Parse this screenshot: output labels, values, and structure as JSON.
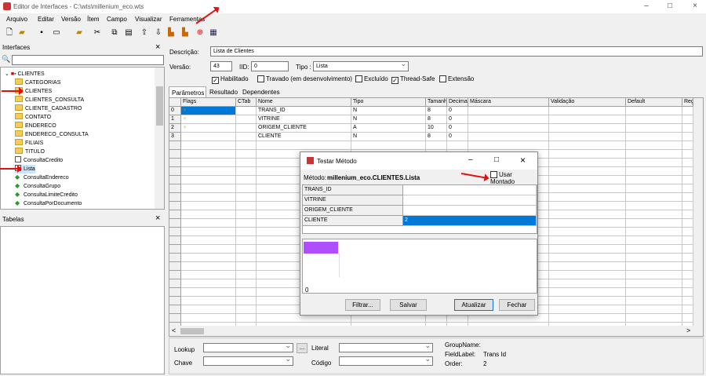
{
  "window": {
    "title": "Editor de Interfaces - C:\\wts\\millenium_eco.wts"
  },
  "menu": [
    "Arquivo",
    "Editar",
    "Versão",
    "Ítem",
    "Campo",
    "Visualizar",
    "Ferramentas"
  ],
  "interfaces_panel": {
    "title": "Interfaces",
    "close": "×",
    "root": "CLIENTES",
    "items": [
      {
        "label": "CATEGORIAS",
        "icon": "folder"
      },
      {
        "label": "CLIENTES",
        "icon": "folder"
      },
      {
        "label": "CLIENTES_CONSULTA",
        "icon": "folder"
      },
      {
        "label": "CLIENTE_CADASTRO",
        "icon": "folder"
      },
      {
        "label": "CONTATO",
        "icon": "folder"
      },
      {
        "label": "ENDERECO",
        "icon": "folder"
      },
      {
        "label": "ENDERECO_CONSULTA",
        "icon": "folder"
      },
      {
        "label": "FILIAIS",
        "icon": "folder"
      },
      {
        "label": "TITULO",
        "icon": "folder"
      },
      {
        "label": "ConsultaCredito",
        "icon": "doc"
      },
      {
        "label": "Lista",
        "icon": "doc"
      },
      {
        "label": "ConsultaEndereco",
        "icon": "green"
      },
      {
        "label": "ConsultaGrupo",
        "icon": "green"
      },
      {
        "label": "ConsultaLimiteCredito",
        "icon": "green"
      },
      {
        "label": "ConsultaPorDocumento",
        "icon": "green"
      }
    ]
  },
  "tabelas_panel": {
    "title": "Tabelas",
    "close": "×"
  },
  "form": {
    "descricao_label": "Descrição:",
    "descricao_value": "Lista de Clientes",
    "versao_label": "Versão:",
    "versao_value": "43",
    "iid_label": "IID:",
    "iid_value": "0",
    "tipo_label": "Tipo :",
    "tipo_value": "Lista",
    "checks": [
      {
        "label": "Habilitado",
        "checked": true
      },
      {
        "label": "Travado (em desenvolvimento)",
        "checked": false
      },
      {
        "label": "Excluído",
        "checked": false
      },
      {
        "label": "Thread-Safe",
        "checked": true
      },
      {
        "label": "Extensão",
        "checked": false
      }
    ]
  },
  "tabs": [
    "Parâmetros",
    "Resultado",
    "Dependentes"
  ],
  "grid": {
    "columns": [
      "Flags",
      "CTab",
      "Nome",
      "Tipo",
      "Tamanh",
      "Decima",
      "Máscara",
      "Validação",
      "Default",
      "Reg"
    ],
    "rows": [
      {
        "n": "0",
        "nome": "TRANS_ID",
        "tipo": "N",
        "tam": "8",
        "dec": "0"
      },
      {
        "n": "1",
        "nome": "VITRINE",
        "tipo": "N",
        "tam": "8",
        "dec": "0"
      },
      {
        "n": "2",
        "nome": "ORIGEM_CLIENTE",
        "tipo": "A",
        "tam": "10",
        "dec": "0"
      },
      {
        "n": "3",
        "nome": "CLIENTE",
        "tipo": "N",
        "tam": "8",
        "dec": "0"
      }
    ]
  },
  "bottom": {
    "lookup": "Lookup",
    "chave": "Chave",
    "literal": "Literal",
    "codigo": "Código",
    "ellipsis": "...",
    "groupname": "GroupName:",
    "fieldlabel": "FieldLabel:",
    "fieldlabel_value": "Trans Id",
    "order": "Order:",
    "order_value": "2"
  },
  "dialog": {
    "title": "Testar Método",
    "metodo_label": "Método:",
    "metodo_value": "millenium_eco.CLIENTES.Lista",
    "usar_montado": "Usar Montado",
    "params": [
      {
        "name": "TRANS_ID",
        "value": ""
      },
      {
        "name": "VITRINE",
        "value": ""
      },
      {
        "name": "ORIGEM_CLIENTE",
        "value": ""
      },
      {
        "name": "CLIENTE",
        "value": "2"
      }
    ],
    "result_count": "0",
    "buttons": {
      "filtrar": "Filtrar...",
      "salvar": "Salvar",
      "atualizar": "Atualizar",
      "fechar": "Fechar"
    },
    "accent": "#0078d7",
    "swatch": "#b04dff"
  }
}
